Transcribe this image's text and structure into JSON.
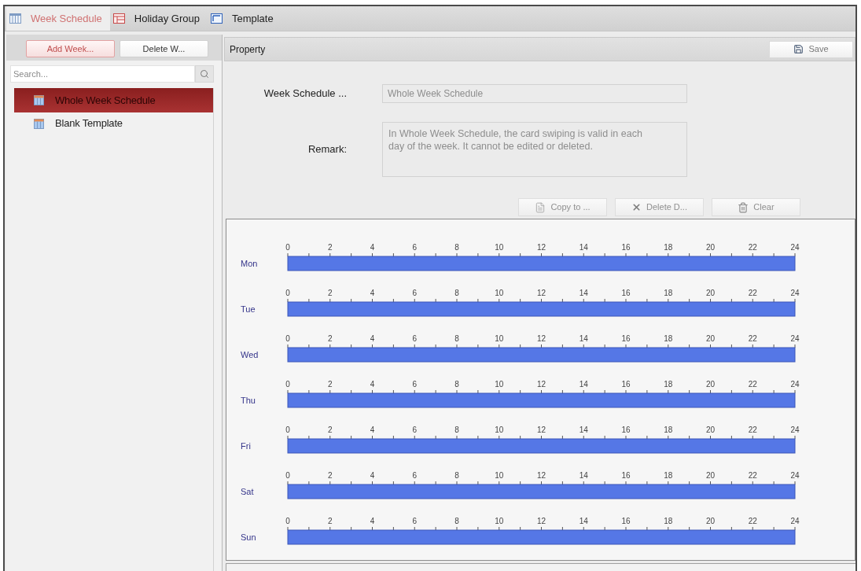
{
  "tabs": [
    {
      "label": "Week Schedule",
      "selected": true
    },
    {
      "label": "Holiday Group",
      "selected": false
    },
    {
      "label": "Template",
      "selected": false
    }
  ],
  "sidebar": {
    "buttons": [
      {
        "label": "Add Week...",
        "highlighted": true
      },
      {
        "label": "Delete W...",
        "highlighted": false
      }
    ],
    "search": {
      "placeholder": "Search..."
    },
    "items": [
      {
        "label": "Whole Week Schedule",
        "selected": true
      },
      {
        "label": "Blank Template",
        "selected": false
      }
    ]
  },
  "property": {
    "title": "Property",
    "save_button": "Save",
    "fields": [
      {
        "kind": "input",
        "label": "Week Schedule ...",
        "value": "Whole Week Schedule",
        "disabled": true
      },
      {
        "kind": "textarea",
        "label": "Remark:",
        "value": "In Whole Week Schedule, the card swiping is valid in each day of the week. It cannot be edited or deleted.",
        "disabled": true
      }
    ],
    "actions": [
      {
        "label": "Copy to ...",
        "disabled": true
      },
      {
        "label": "Delete D...",
        "disabled": true
      },
      {
        "label": "Clear",
        "disabled": true
      }
    ]
  },
  "schedule": {
    "chart_data": [
      {
        "type": "bar",
        "orientation": "horizontal",
        "categories": [
          "Mon"
        ],
        "base": [
          0
        ],
        "values": [
          24
        ],
        "color": "#5577e6",
        "xlim": [
          0,
          24
        ],
        "xticks": [
          0,
          2,
          4,
          6,
          8,
          10,
          12,
          14,
          16,
          18,
          20,
          22,
          24
        ]
      },
      {
        "type": "bar",
        "orientation": "horizontal",
        "categories": [
          "Tue"
        ],
        "base": [
          0
        ],
        "values": [
          24
        ],
        "color": "#5577e6",
        "xlim": [
          0,
          24
        ],
        "xticks": [
          0,
          2,
          4,
          6,
          8,
          10,
          12,
          14,
          16,
          18,
          20,
          22,
          24
        ]
      },
      {
        "type": "bar",
        "orientation": "horizontal",
        "categories": [
          "Wed"
        ],
        "base": [
          0
        ],
        "values": [
          24
        ],
        "color": "#5577e6",
        "xlim": [
          0,
          24
        ],
        "xticks": [
          0,
          2,
          4,
          6,
          8,
          10,
          12,
          14,
          16,
          18,
          20,
          22,
          24
        ]
      },
      {
        "type": "bar",
        "orientation": "horizontal",
        "categories": [
          "Thu"
        ],
        "base": [
          0
        ],
        "values": [
          24
        ],
        "color": "#5577e6",
        "xlim": [
          0,
          24
        ],
        "xticks": [
          0,
          2,
          4,
          6,
          8,
          10,
          12,
          14,
          16,
          18,
          20,
          22,
          24
        ]
      },
      {
        "type": "bar",
        "orientation": "horizontal",
        "categories": [
          "Fri"
        ],
        "base": [
          0
        ],
        "values": [
          24
        ],
        "color": "#5577e6",
        "xlim": [
          0,
          24
        ],
        "xticks": [
          0,
          2,
          4,
          6,
          8,
          10,
          12,
          14,
          16,
          18,
          20,
          22,
          24
        ]
      },
      {
        "type": "bar",
        "orientation": "horizontal",
        "categories": [
          "Sat"
        ],
        "base": [
          0
        ],
        "values": [
          24
        ],
        "color": "#5577e6",
        "xlim": [
          0,
          24
        ],
        "xticks": [
          0,
          2,
          4,
          6,
          8,
          10,
          12,
          14,
          16,
          18,
          20,
          22,
          24
        ]
      },
      {
        "type": "bar",
        "orientation": "horizontal",
        "categories": [
          "Sun"
        ],
        "base": [
          0
        ],
        "values": [
          24
        ],
        "color": "#5577e6",
        "xlim": [
          0,
          24
        ],
        "xticks": [
          0,
          2,
          4,
          6,
          8,
          10,
          12,
          14,
          16,
          18,
          20,
          22,
          24
        ]
      }
    ]
  }
}
